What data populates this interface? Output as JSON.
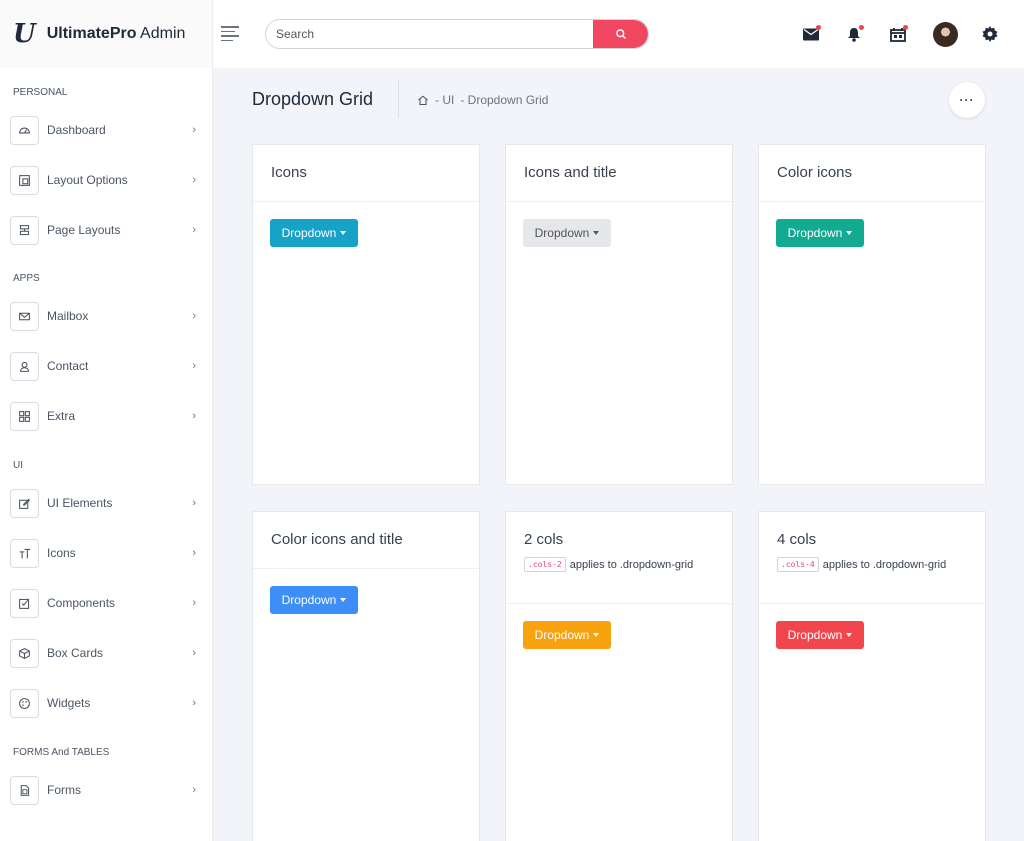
{
  "brand": {
    "logo": "U",
    "name_bold": "UltimatePro",
    "name_rest": "Admin"
  },
  "sidebar": {
    "sections": [
      {
        "title": "PERSONAL",
        "items": [
          {
            "label": "Dashboard",
            "icon": "dashboard-icon"
          },
          {
            "label": "Layout Options",
            "icon": "layout-icon"
          },
          {
            "label": "Page Layouts",
            "icon": "page-layouts-icon"
          }
        ]
      },
      {
        "title": "APPS",
        "items": [
          {
            "label": "Mailbox",
            "icon": "mail-icon"
          },
          {
            "label": "Contact",
            "icon": "user-icon"
          },
          {
            "label": "Extra",
            "icon": "grid-icon"
          }
        ]
      },
      {
        "title": "UI",
        "items": [
          {
            "label": "UI Elements",
            "icon": "edit-icon"
          },
          {
            "label": "Icons",
            "icon": "text-icon"
          },
          {
            "label": "Components",
            "icon": "checkbox-icon"
          },
          {
            "label": "Box Cards",
            "icon": "box-icon"
          },
          {
            "label": "Widgets",
            "icon": "palette-icon"
          }
        ]
      },
      {
        "title": "FORMS And TABLES",
        "items": [
          {
            "label": "Forms",
            "icon": "forms-icon"
          }
        ]
      }
    ]
  },
  "topbar": {
    "search_placeholder": "Search"
  },
  "page": {
    "title": "Dropdown Grid",
    "breadcrumb": [
      "- UI",
      "- Dropdown Grid"
    ],
    "more_label": "···"
  },
  "cards": [
    {
      "title": "Icons",
      "button": "Dropdown",
      "color": "#17a2c8",
      "text_color": "#ffffff"
    },
    {
      "title": "Icons and title",
      "button": "Dropdown",
      "color": "#e5e7eb",
      "text_color": "#555555"
    },
    {
      "title": "Color icons",
      "button": "Dropdown",
      "color": "#13aa92",
      "text_color": "#ffffff"
    },
    {
      "title": "Color icons and title",
      "button": "Dropdown",
      "color": "#3e8ef7",
      "text_color": "#ffffff"
    },
    {
      "title": "2 cols",
      "code": ".cols-2",
      "note": "applies to .dropdown-grid",
      "button": "Dropdown",
      "color": "#f9a20f",
      "text_color": "#ffffff"
    },
    {
      "title": "4 cols",
      "code": ".cols-4",
      "note": "applies to .dropdown-grid",
      "button": "Dropdown",
      "color": "#f2464f",
      "text_color": "#ffffff"
    }
  ]
}
